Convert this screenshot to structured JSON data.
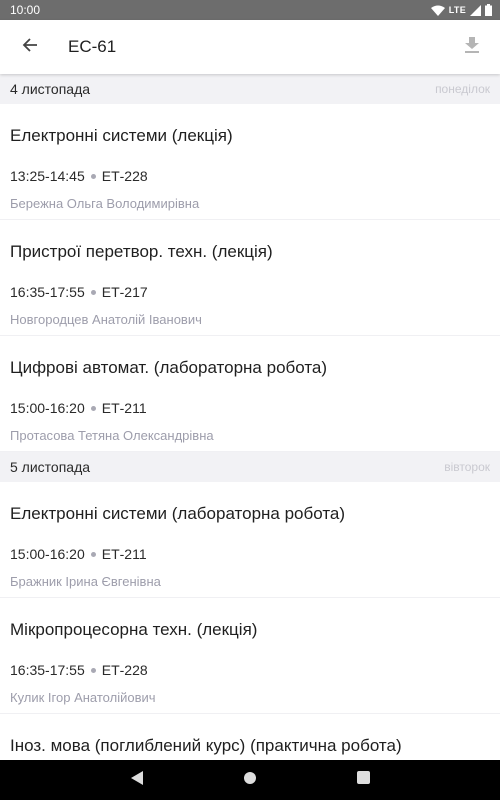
{
  "status_bar": {
    "time": "10:00",
    "network": "LTE"
  },
  "app_bar": {
    "title": "ЕС-61",
    "back_icon": "arrow-back-icon",
    "download_icon": "download-icon"
  },
  "days": [
    {
      "date": "4 листопада",
      "weekday": "понеділок",
      "lessons": [
        {
          "name": "Електронні системи (лекція)",
          "time": "13:25-14:45",
          "room": "ЕТ-228",
          "teacher": "Бережна Ольга Володимирівна"
        },
        {
          "name": "Пристрої перетвор. техн. (лекція)",
          "time": "16:35-17:55",
          "room": "ЕТ-217",
          "teacher": "Новгородцев Анатолій Іванович"
        },
        {
          "name": "Цифрові автомат. (лабораторна робота)",
          "time": "15:00-16:20",
          "room": "ЕТ-211",
          "teacher": "Протасова Тетяна Олександрівна"
        }
      ]
    },
    {
      "date": "5 листопада",
      "weekday": "вівторок",
      "lessons": [
        {
          "name": "Електронні системи (лабораторна робота)",
          "time": "15:00-16:20",
          "room": "ЕТ-211",
          "teacher": "Бражник Ірина Євгенівна"
        },
        {
          "name": "Мікропроцесорна техн. (лекція)",
          "time": "16:35-17:55",
          "room": "ЕТ-228",
          "teacher": "Кулик Ігор Анатолійович"
        },
        {
          "name": "Іноз. мова (поглиблений курс) (практична робота)"
        }
      ]
    }
  ],
  "nav_bar": {
    "back_icon": "triangle-back-icon",
    "home_icon": "circle-home-icon",
    "recents_icon": "square-recents-icon"
  }
}
